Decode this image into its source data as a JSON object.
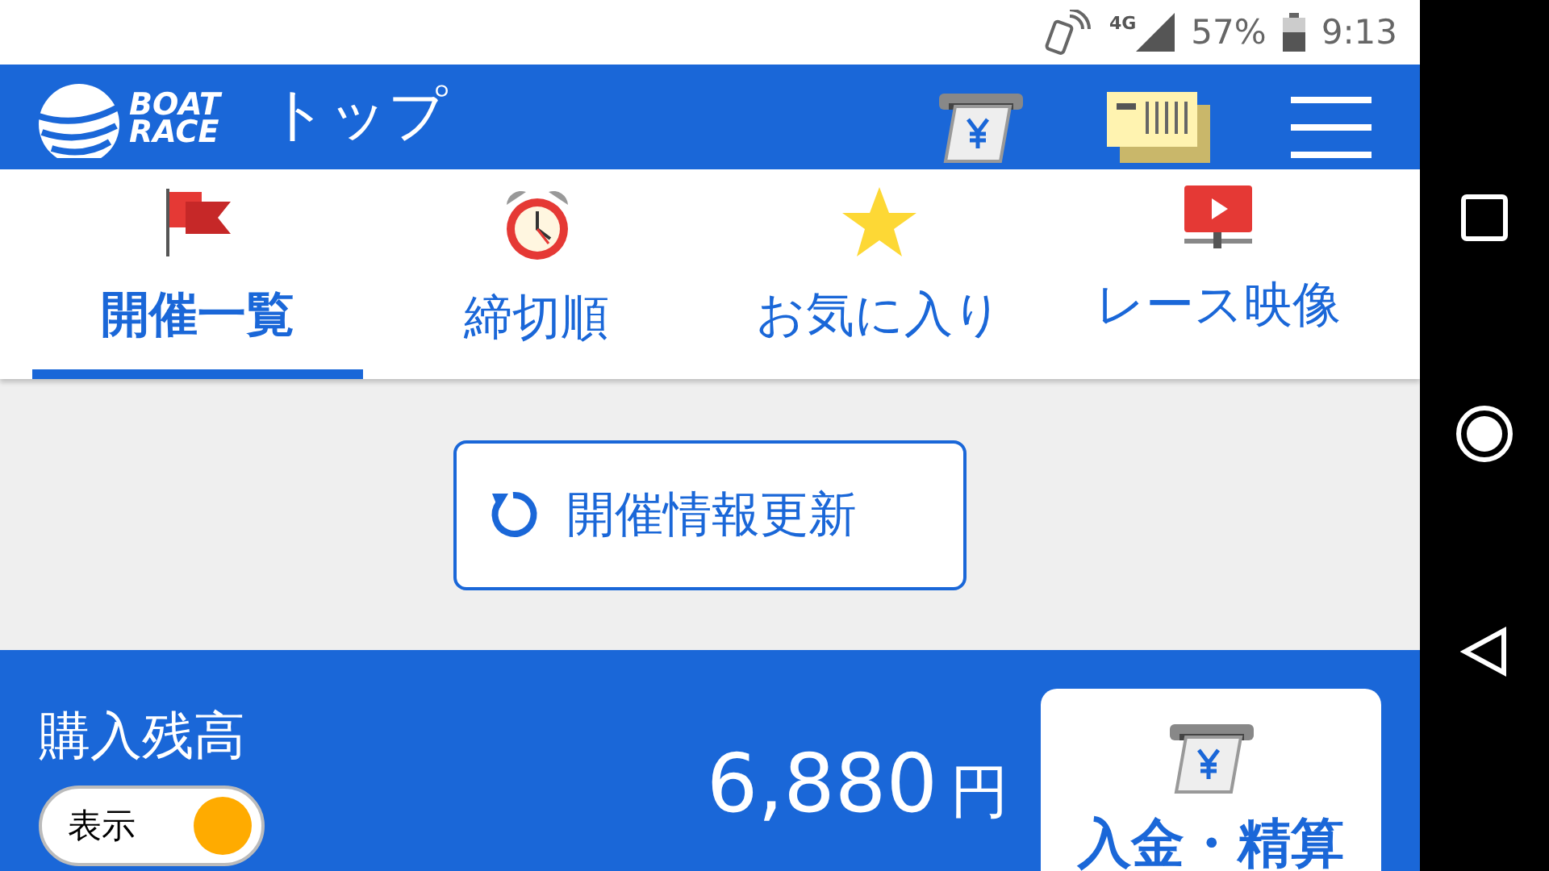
{
  "status_bar": {
    "network": "4G",
    "battery": "57%",
    "time": "9:13"
  },
  "header": {
    "logo_lines": [
      "BOAT",
      "RACE"
    ],
    "title": "トップ"
  },
  "tabs": [
    {
      "label": "開催一覧",
      "kind": "flag",
      "selected": true
    },
    {
      "label": "締切順",
      "kind": "clock",
      "selected": false
    },
    {
      "label": "お気に入り",
      "kind": "star",
      "selected": false
    },
    {
      "label": "レース映像",
      "kind": "video",
      "selected": false
    }
  ],
  "refresh_button": {
    "label": "開催情報更新"
  },
  "balance": {
    "title": "購入残高",
    "toggle": {
      "label": "表示",
      "on": true
    },
    "amount": "6,880",
    "unit": "円",
    "deposit_button": "入金・精算"
  }
}
